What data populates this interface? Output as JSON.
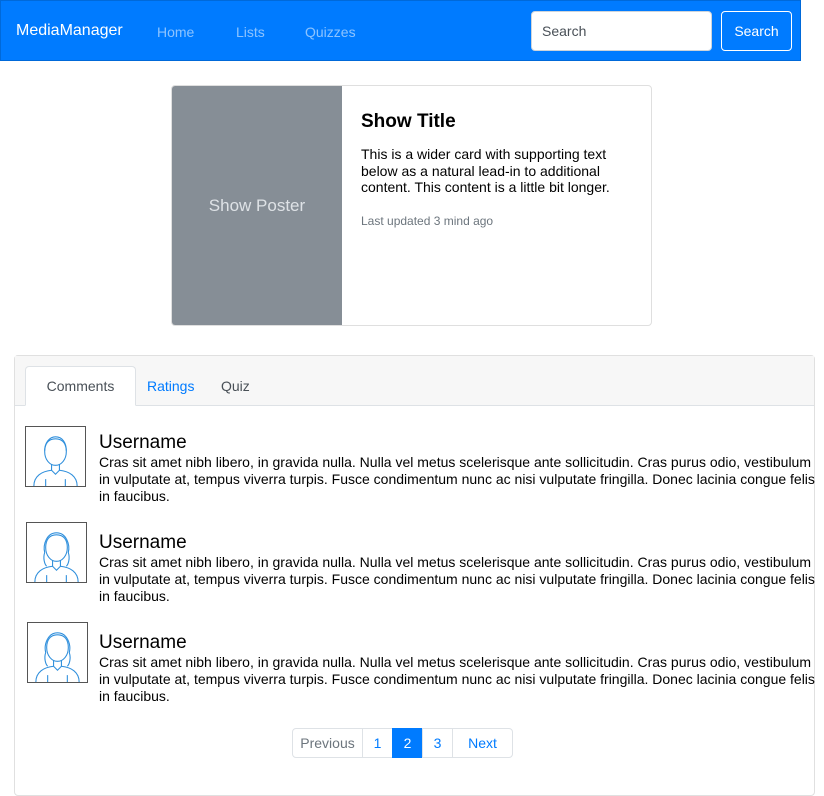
{
  "navbar": {
    "brand": "MediaManager",
    "links": [
      "Home",
      "Lists",
      "Quizzes"
    ],
    "search_placeholder": "Search",
    "search_button": "Search"
  },
  "card": {
    "poster_label": "Show Poster",
    "title": "Show Title",
    "text": "This is a wider card with supporting text below as a natural lead-in to additional content. This content is a little bit longer.",
    "updated": "Last updated 3 mind ago"
  },
  "tabs": [
    "Comments",
    "Ratings",
    "Quiz"
  ],
  "active_tab": "Comments",
  "comments": [
    {
      "username": "Username",
      "text": "Cras sit amet nibh libero, in gravida nulla. Nulla vel metus scelerisque ante sollicitudin. Cras purus odio, vestibulum in vulputate at, tempus viverra turpis. Fusce condimentum nunc ac nisi vulputate fringilla. Donec lacinia congue felis in faucibus."
    },
    {
      "username": "Username",
      "text": "Cras sit amet nibh libero, in gravida nulla. Nulla vel metus scelerisque ante sollicitudin. Cras purus odio, vestibulum in vulputate at, tempus viverra turpis. Fusce condimentum nunc ac nisi vulputate fringilla. Donec lacinia congue felis in faucibus."
    },
    {
      "username": "Username",
      "text": "Cras sit amet nibh libero, in gravida nulla. Nulla vel metus scelerisque ante sollicitudin. Cras purus odio, vestibulum in vulputate at, tempus viverra turpis. Fusce condimentum nunc ac nisi vulputate fringilla. Donec lacinia congue felis in faucibus."
    }
  ],
  "pagination": {
    "previous": "Previous",
    "pages": [
      "1",
      "2",
      "3"
    ],
    "active": "2",
    "next": "Next"
  },
  "colors": {
    "primary": "#007bff",
    "poster_bg": "#868e96"
  },
  "icons": {
    "avatar": "user-avatar-icon"
  }
}
